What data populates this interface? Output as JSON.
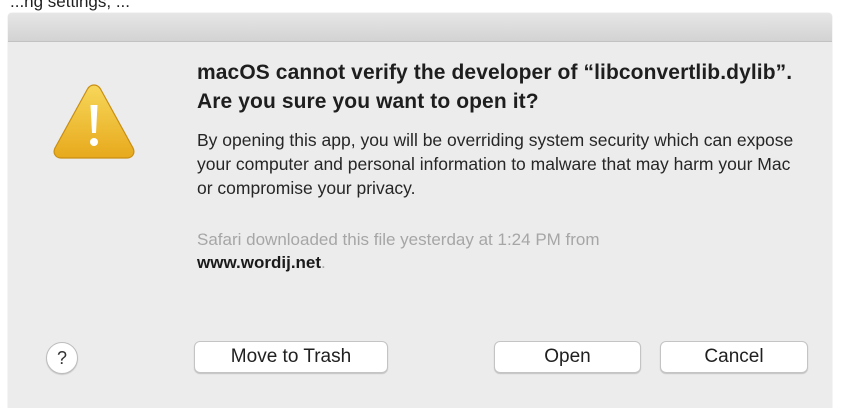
{
  "background_caption": "...ng settings, ...",
  "dialog": {
    "headline": "macOS cannot verify the developer of “libconvertlib.dylib”. Are you sure you want to open it?",
    "body": "By opening this app, you will be overriding system security which can expose your computer and personal information to malware that may harm your Mac or compromise your privacy.",
    "download_prefix": "Safari downloaded this file yesterday at 1:24 PM from",
    "download_site": "www.wordij.net",
    "download_suffix": ".",
    "icon": "warning-triangle-icon",
    "icon_color": "#F2C230"
  },
  "buttons": {
    "help_label": "?",
    "trash_label": "Move to Trash",
    "open_label": "Open",
    "cancel_label": "Cancel"
  }
}
